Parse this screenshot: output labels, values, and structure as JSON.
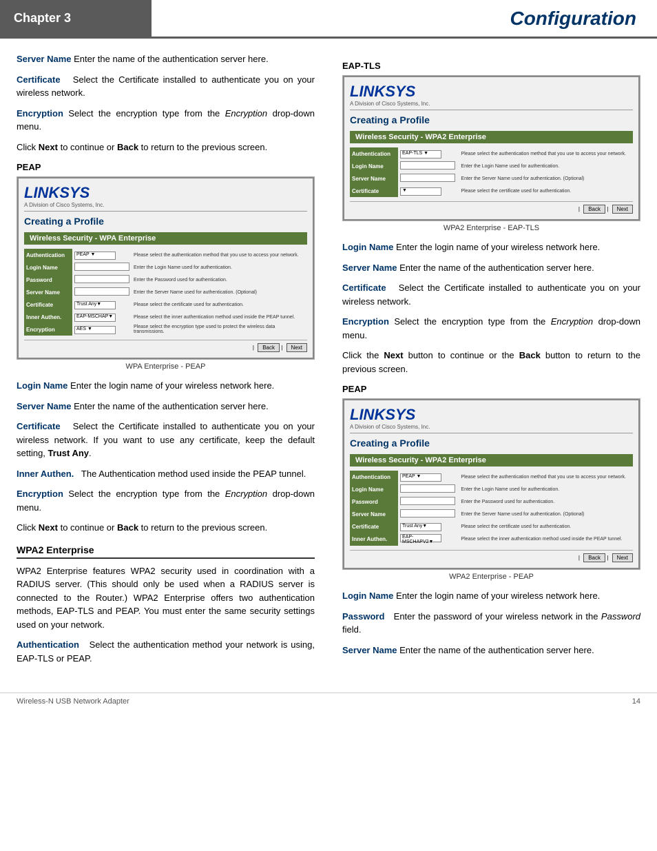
{
  "header": {
    "chapter": "Chapter 3",
    "title": "Configuration"
  },
  "footer": {
    "product": "Wireless-N USB Network Adapter",
    "page": "14"
  },
  "left_col": {
    "paragraphs": [
      {
        "term": "Server Name",
        "text": " Enter the name of the authentication server here."
      },
      {
        "term": "Certificate",
        "text": "  Select the Certificate installed to authenticate you on your wireless network."
      },
      {
        "term": "Encryption",
        "text": " Select  the  encryption  type  from  the Encryption drop-down menu."
      }
    ],
    "next_back_text": "Click Next to continue or Back to return to the previous screen.",
    "section1_label": "PEAP",
    "screenshot1_caption": "WPA Enterprise - PEAP",
    "screenshot1": {
      "logo": "LINKSYS",
      "logo_sub": "A Division of Cisco Systems, Inc.",
      "profile_title": "Creating a Profile",
      "security_bar": "Wireless Security - WPA Enterprise",
      "rows": [
        {
          "label": "Authentication",
          "input": "PEAP",
          "type": "select",
          "desc": "Please select the authentication method that you use to access your network."
        },
        {
          "label": "Login Name",
          "input": "",
          "type": "text",
          "desc": "Enter the Login Name used for authentication."
        },
        {
          "label": "Password",
          "input": "",
          "type": "text",
          "desc": "Enter the Password used for authentication."
        },
        {
          "label": "Server Name",
          "input": "",
          "type": "text",
          "desc": "Enter the Server Name used for authentication. (Optional)"
        },
        {
          "label": "Certificate",
          "input": "Trust Any",
          "type": "select",
          "desc": "Please select the certificate used for authentication."
        },
        {
          "label": "Inner Authen.",
          "input": "EAP-MSCHAPV2",
          "type": "select",
          "desc": "Please select the inner authentication method used inside the PEAP tunnel."
        },
        {
          "label": "Encryption",
          "input": "AES",
          "type": "select",
          "desc": "Please select the encryption type used to protect the wireless data transmissions."
        }
      ],
      "buttons": [
        "Back",
        "Next"
      ]
    },
    "para2": [
      {
        "term": "Login Name",
        "text": " Enter  the  login  name  of  your  wireless network here."
      },
      {
        "term": "Server Name",
        "text": " Enter  the  name  of  the  authentication server here."
      },
      {
        "term": "Certificate",
        "text": "  Select the Certificate installed to authenticate you  on  your  wireless  network.   If  you  want  to  use  any certificate, keep the default setting, Trust Any."
      },
      {
        "term": "Inner Authen.",
        "text": "  The  Authentication  method  used  inside the PEAP tunnel."
      },
      {
        "term": "Encryption",
        "text": " Select  the  encryption  type  from  the Encryption drop-down menu."
      }
    ],
    "next_back_text2": "Click Next to continue or Back to return to the previous screen.",
    "subsection": "WPA2 Enterprise",
    "wpa2_text": "WPA2  Enterprise  features  WPA2  security  used  in coordination  with  a  RADIUS  server.  (This  should  only  be used  when  a  RADIUS  server  is  connected  to  the  Router.) WPA2 Enterprise offers two authentication methods, EAP-TLS and PEAP. You must enter the same security settings used on your network.",
    "auth_para": {
      "term": "Authentication",
      "text": "  Select  the  authentication  method  your network is using, EAP-TLS or PEAP."
    }
  },
  "right_col": {
    "section1_label": "EAP-TLS",
    "screenshot1_caption": "WPA2 Enterprise - EAP-TLS",
    "screenshot1": {
      "logo": "LINKSYS",
      "logo_sub": "A Division of Cisco Systems, Inc.",
      "profile_title": "Creating a Profile",
      "security_bar": "Wireless Security - WPA2 Enterprise",
      "rows": [
        {
          "label": "Authentication",
          "input": "EAP-TLS",
          "type": "select",
          "desc": "Please select the authentication method that you use to access your network."
        },
        {
          "label": "Login Name",
          "input": "",
          "type": "text",
          "desc": "Enter the Login Name used for authentication."
        },
        {
          "label": "Server Name",
          "input": "",
          "type": "text",
          "desc": "Enter the Server Name used for authentication. (Optional)"
        },
        {
          "label": "Certificate",
          "input": "",
          "type": "select",
          "desc": "Please select the certificate used for authentication."
        }
      ],
      "buttons": [
        "Back",
        "Next"
      ]
    },
    "para1": [
      {
        "term": "Login Name",
        "text": " Enter  the  login  name  of  your  wireless network here."
      },
      {
        "term": "Server Name",
        "text": " Enter  the  name  of  the  authentication server here."
      },
      {
        "term": "Certificate",
        "text": "  Select the Certificate installed to authenticate you on your wireless network."
      },
      {
        "term": "Encryption",
        "text": " Select  the  encryption  type  from  the Encryption drop-down menu."
      }
    ],
    "next_back_text": "Click the Next button to continue or the Back button to return to the previous screen.",
    "section2_label": "PEAP",
    "screenshot2_caption": "WPA2 Enterprise - PEAP",
    "screenshot2": {
      "logo": "LINKSYS",
      "logo_sub": "A Division of Cisco Systems, Inc.",
      "profile_title": "Creating a Profile",
      "security_bar": "Wireless Security - WPA2 Enterprise",
      "rows": [
        {
          "label": "Authentication",
          "input": "PEAP",
          "type": "select",
          "desc": "Please select the authentication method that you use to access your network."
        },
        {
          "label": "Login Name",
          "input": "",
          "type": "text",
          "desc": "Enter the Login Name used for authentication."
        },
        {
          "label": "Password",
          "input": "",
          "type": "text",
          "desc": "Enter the Password used for authentication."
        },
        {
          "label": "Server Name",
          "input": "",
          "type": "text",
          "desc": "Enter the Server Name used for authentication. (Optional)"
        },
        {
          "label": "Certificate",
          "input": "Trust Any",
          "type": "select",
          "desc": "Please select the certificate used for authentication."
        },
        {
          "label": "Inner Authen.",
          "input": "EAP-MSCHAPV2",
          "type": "select",
          "desc": "Please select the inner authentication method used inside the PEAP tunnel."
        }
      ],
      "buttons": [
        "Back",
        "Next"
      ]
    },
    "para2": [
      {
        "term": "Login Name",
        "text": " Enter  the  login  name  of  your  wireless network here."
      },
      {
        "term": "Password",
        "text": "  Enter the password of your wireless network in the Password field."
      },
      {
        "term": "Server Name",
        "text": " Enter  the  name  of  the  authentication server here."
      }
    ]
  }
}
